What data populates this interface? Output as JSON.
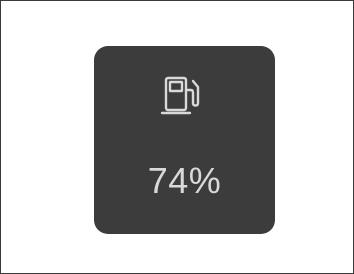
{
  "widget": {
    "icon": "fuel-pump-icon",
    "fuel_level": "74%",
    "colors": {
      "tile_background": "#3c3c3c",
      "foreground": "#d9d9d9",
      "page_background": "#ffffff"
    }
  }
}
